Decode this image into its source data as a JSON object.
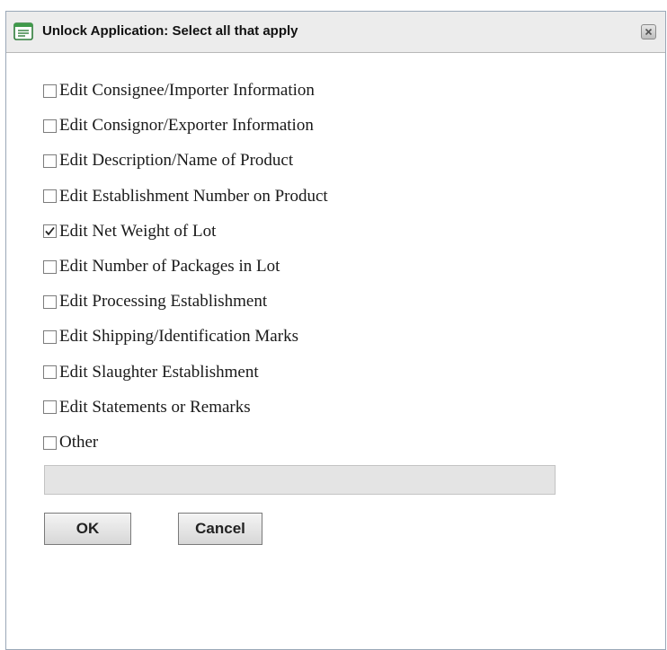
{
  "dialog": {
    "title": "Unlock Application: Select all that apply",
    "title_icon": "form-icon",
    "close_icon": "close-icon"
  },
  "options": [
    {
      "label": "Edit Consignee/Importer Information",
      "checked": false
    },
    {
      "label": "Edit Consignor/Exporter Information",
      "checked": false
    },
    {
      "label": "Edit Description/Name of Product",
      "checked": false
    },
    {
      "label": "Edit Establishment Number on Product",
      "checked": false
    },
    {
      "label": "Edit Net Weight of Lot",
      "checked": true
    },
    {
      "label": "Edit Number of Packages in Lot",
      "checked": false
    },
    {
      "label": "Edit Processing Establishment",
      "checked": false
    },
    {
      "label": "Edit Shipping/Identification Marks",
      "checked": false
    },
    {
      "label": "Edit Slaughter Establishment",
      "checked": false
    },
    {
      "label": "Edit Statements or Remarks",
      "checked": false
    },
    {
      "label": "Other",
      "checked": false
    }
  ],
  "other_input": {
    "value": "",
    "placeholder": "",
    "disabled": true
  },
  "buttons": {
    "ok": "OK",
    "cancel": "Cancel"
  }
}
